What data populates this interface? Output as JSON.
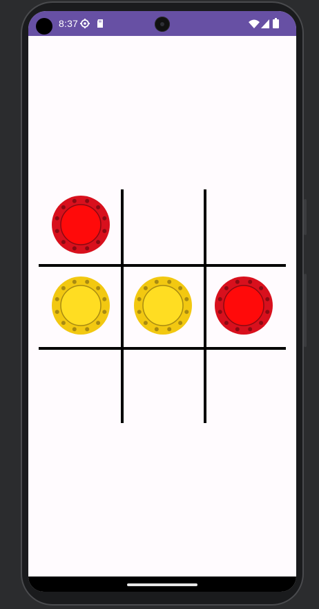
{
  "status_bar": {
    "time": "8:37",
    "icons": [
      "settings-icon",
      "sd-card-icon",
      "wifi-icon",
      "signal-icon",
      "battery-icon"
    ],
    "background": "#6750a4"
  },
  "game": {
    "grid_rows": 3,
    "grid_cols": 3,
    "cells": [
      [
        "red",
        null,
        null
      ],
      [
        "yellow",
        "yellow",
        "red"
      ],
      [
        null,
        null,
        null
      ]
    ],
    "colors": {
      "red_outer": "#d8101d",
      "red_inner": "#ff0a0a",
      "red_dot": "#8a0a12",
      "yellow_outer": "#f2c811",
      "yellow_inner": "#ffdd22",
      "yellow_dot": "#a88a12",
      "grid_line": "#000000",
      "background": "#fffbfe"
    }
  }
}
